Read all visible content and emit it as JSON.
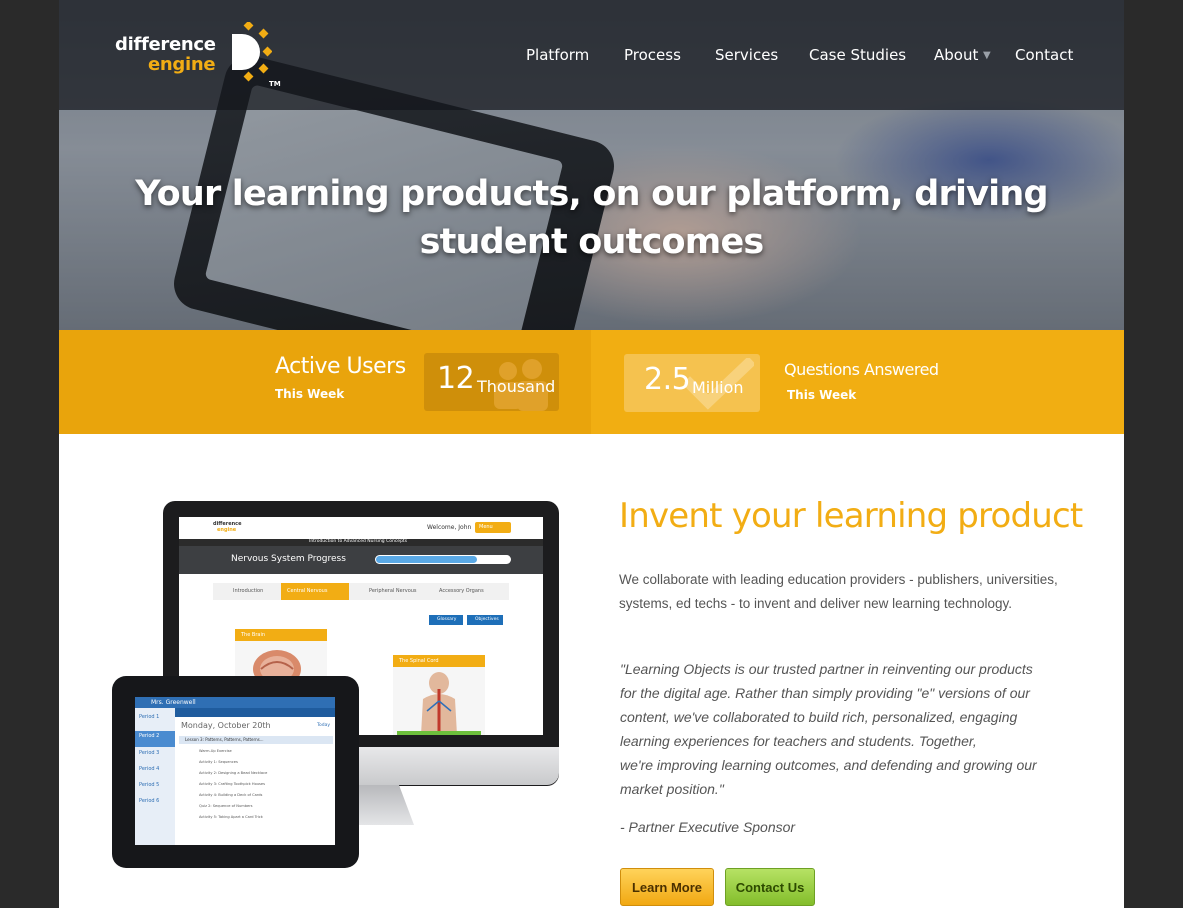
{
  "brand": {
    "logo_line1": "difference",
    "logo_line2": "engine",
    "trademark": "TM",
    "accent_color": "#f2ad14",
    "secondary_color": "#8cc63f"
  },
  "nav": {
    "items": [
      {
        "label": "Platform"
      },
      {
        "label": "Process"
      },
      {
        "label": "Services"
      },
      {
        "label": "Case Studies"
      },
      {
        "label": "About",
        "has_dropdown": true
      },
      {
        "label": "Contact"
      }
    ]
  },
  "hero": {
    "headline_line1": "Your learning products, on our platform, driving",
    "headline_line2": "student outcomes"
  },
  "stats": [
    {
      "title": "Active Users",
      "subtitle": "This Week",
      "value": "12",
      "unit": "Thousand",
      "icon": "users-icon"
    },
    {
      "title": "Questions Answered",
      "subtitle": "This Week",
      "value": "2.5",
      "unit": "Million",
      "icon": "checkmark-icon"
    }
  ],
  "mockup": {
    "monitor": {
      "welcome": "Welcome, John",
      "menu_label": "Menu",
      "course_title": "Introduction to Advanced Nursing Concepts",
      "progress_title": "Nervous System Progress",
      "tabs": [
        "Introduction",
        "Central Nervous",
        "Peripheral Nervous",
        "Accessory Organs"
      ],
      "buttons": [
        "Glossary",
        "Objectives"
      ],
      "card1": "The Brain",
      "card2": "The Spinal Cord"
    },
    "ipad": {
      "teacher": "Mrs. Greenwell",
      "periods": [
        "Period 1",
        "Period 2",
        "Period 3",
        "Period 4",
        "Period 5",
        "Period 6"
      ],
      "date": "Monday, October 20th",
      "today": "Today",
      "lesson": "Lesson 3: Patterns, Patterns, Patterns...",
      "activities": [
        "Warm-Up Exercise",
        "Activity 1: Sequences",
        "Activity 2: Designing a Bead Necklace",
        "Activity 3: Crafting Toothpick Houses",
        "Activity 4: Building a Deck of Cards",
        "Quiz 2: Sequence of Numbers",
        "Activity 5: Taking Apart a Card Trick"
      ]
    }
  },
  "content": {
    "title": "Invent your learning product",
    "paragraph": "We collaborate with leading education providers - publishers, universities, systems, ed techs - to invent and deliver new learning technology.",
    "quote_lines": [
      "\"Learning Objects is our trusted partner in reinventing our products",
      "for the digital age. Rather than simply providing \"e\" versions of our",
      "content, we've collaborated to build rich, personalized, engaging",
      "learning experiences for teachers and students.  Together,",
      "we're improving learning outcomes, and defending and growing our",
      "market position.\""
    ],
    "sponsor": "- Partner Executive Sponsor",
    "learn_more": "Learn More",
    "contact_us": "Contact Us"
  }
}
